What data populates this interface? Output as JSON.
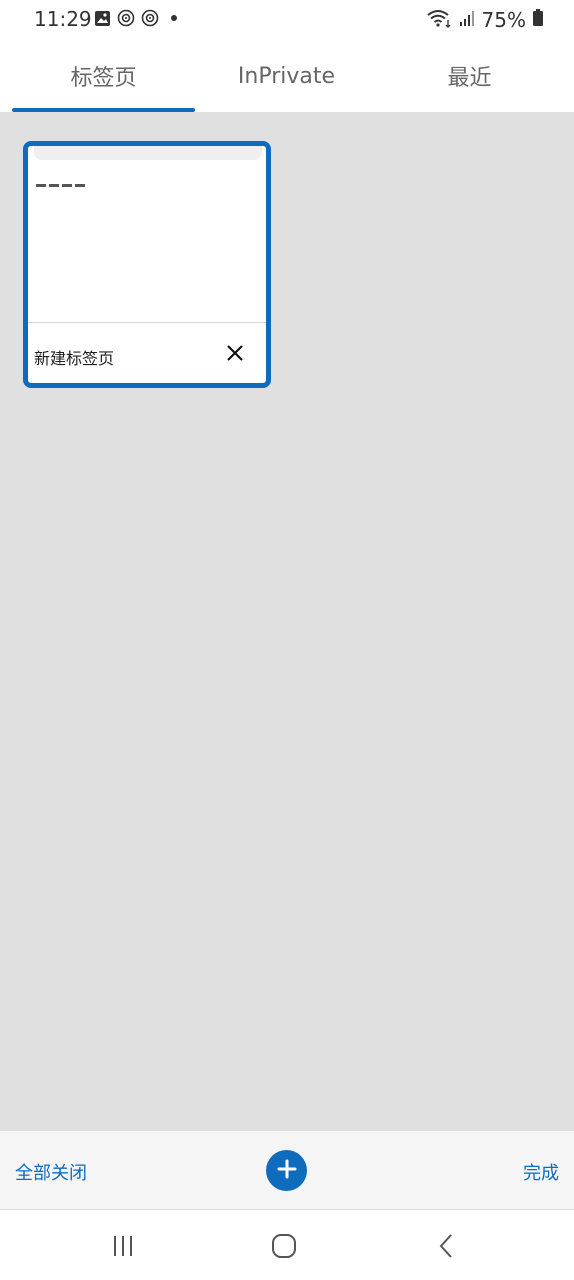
{
  "status_bar": {
    "time": "11:29",
    "battery": "75%",
    "icons_left": [
      "image-icon",
      "sync-icon",
      "sync-icon",
      "dot-icon"
    ],
    "icons_right": [
      "wifi-icon",
      "signal-icon",
      "battery-icon"
    ]
  },
  "tabs": [
    {
      "label": "标签页",
      "active": true
    },
    {
      "label": "InPrivate",
      "active": false
    },
    {
      "label": "最近",
      "active": false
    }
  ],
  "tab_cards": [
    {
      "title": "新建标签页",
      "selected": true
    }
  ],
  "toolbar": {
    "close_all_label": "全部关闭",
    "done_label": "完成",
    "add_icon": "plus-icon"
  },
  "nav": {
    "recents_icon": "recents-icon",
    "home_icon": "home-icon",
    "back_icon": "back-icon"
  },
  "colors": {
    "accent": "#0f6cbd",
    "content_bg": "#e0e0e0",
    "toolbar_bg": "#f5f5f5"
  }
}
